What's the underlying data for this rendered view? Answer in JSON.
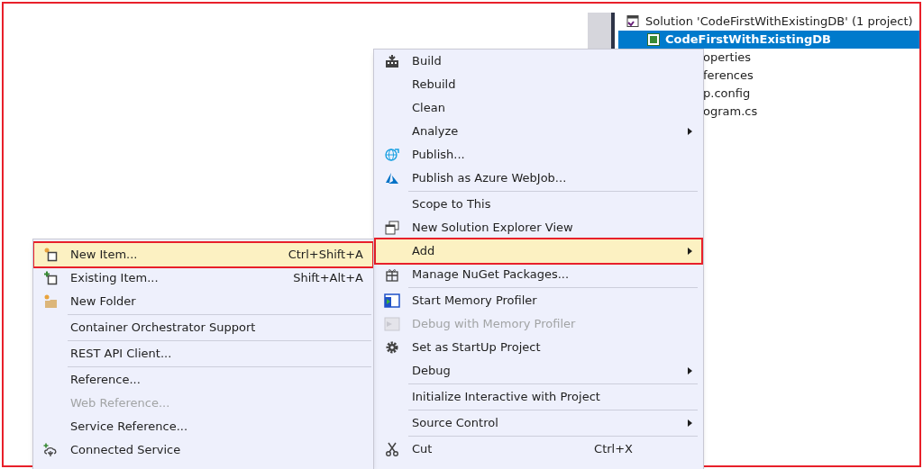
{
  "solution_explorer": {
    "items": [
      {
        "label": "Solution 'CodeFirstWithExistingDB' (1 project)",
        "selected": false,
        "bold": false
      },
      {
        "label": "CodeFirstWithExistingDB",
        "selected": true,
        "bold": true
      },
      {
        "label": "operties",
        "selected": false,
        "bold": false
      },
      {
        "label": "ferences",
        "selected": false,
        "bold": false
      },
      {
        "label": "p.config",
        "selected": false,
        "bold": false
      },
      {
        "label": "ogram.cs",
        "selected": false,
        "bold": false
      }
    ]
  },
  "context_menu": {
    "items": [
      {
        "kind": "item",
        "label": "Build",
        "selected": false,
        "disabled": false
      },
      {
        "kind": "item",
        "label": "Rebuild",
        "selected": false,
        "disabled": false
      },
      {
        "kind": "item",
        "label": "Clean",
        "selected": false,
        "disabled": false
      },
      {
        "kind": "item",
        "label": "Analyze",
        "submenu": true,
        "selected": false,
        "disabled": false
      },
      {
        "kind": "item",
        "label": "Publish...",
        "selected": false,
        "disabled": false
      },
      {
        "kind": "item",
        "label": "Publish as Azure WebJob...",
        "selected": false,
        "disabled": false
      },
      {
        "kind": "separator"
      },
      {
        "kind": "item",
        "label": "Scope to This",
        "selected": false,
        "disabled": false
      },
      {
        "kind": "item",
        "label": "New Solution Explorer View",
        "selected": false,
        "disabled": false
      },
      {
        "kind": "item",
        "label": "Add",
        "submenu": true,
        "selected": true,
        "disabled": false
      },
      {
        "kind": "item",
        "label": "Manage NuGet Packages...",
        "selected": false,
        "disabled": false
      },
      {
        "kind": "separator"
      },
      {
        "kind": "item",
        "label": "Start Memory Profiler",
        "selected": false,
        "disabled": false
      },
      {
        "kind": "item",
        "label": "Debug with Memory Profiler",
        "selected": false,
        "disabled": true
      },
      {
        "kind": "item",
        "label": "Set as StartUp Project",
        "selected": false,
        "disabled": false
      },
      {
        "kind": "item",
        "label": "Debug",
        "submenu": true,
        "selected": false,
        "disabled": false
      },
      {
        "kind": "separator"
      },
      {
        "kind": "item",
        "label": "Initialize Interactive with Project",
        "selected": false,
        "disabled": false
      },
      {
        "kind": "separator"
      },
      {
        "kind": "item",
        "label": "Source Control",
        "submenu": true,
        "selected": false,
        "disabled": false
      },
      {
        "kind": "separator"
      },
      {
        "kind": "item",
        "label": "Cut",
        "shortcut": "Ctrl+X",
        "selected": false,
        "disabled": false
      }
    ]
  },
  "add_submenu": {
    "items": [
      {
        "kind": "item",
        "label": "New Item...",
        "shortcut": "Ctrl+Shift+A",
        "selected": true,
        "disabled": false
      },
      {
        "kind": "item",
        "label": "Existing Item...",
        "shortcut": "Shift+Alt+A",
        "selected": false,
        "disabled": false
      },
      {
        "kind": "item",
        "label": "New Folder",
        "selected": false,
        "disabled": false
      },
      {
        "kind": "separator"
      },
      {
        "kind": "item",
        "label": "Container Orchestrator Support",
        "selected": false,
        "disabled": false
      },
      {
        "kind": "separator"
      },
      {
        "kind": "item",
        "label": "REST API Client...",
        "selected": false,
        "disabled": false
      },
      {
        "kind": "separator"
      },
      {
        "kind": "item",
        "label": "Reference...",
        "selected": false,
        "disabled": false
      },
      {
        "kind": "item",
        "label": "Web Reference...",
        "selected": false,
        "disabled": true
      },
      {
        "kind": "item",
        "label": "Service Reference...",
        "selected": false,
        "disabled": false
      },
      {
        "kind": "item",
        "label": "Connected Service",
        "selected": false,
        "disabled": false
      }
    ]
  }
}
